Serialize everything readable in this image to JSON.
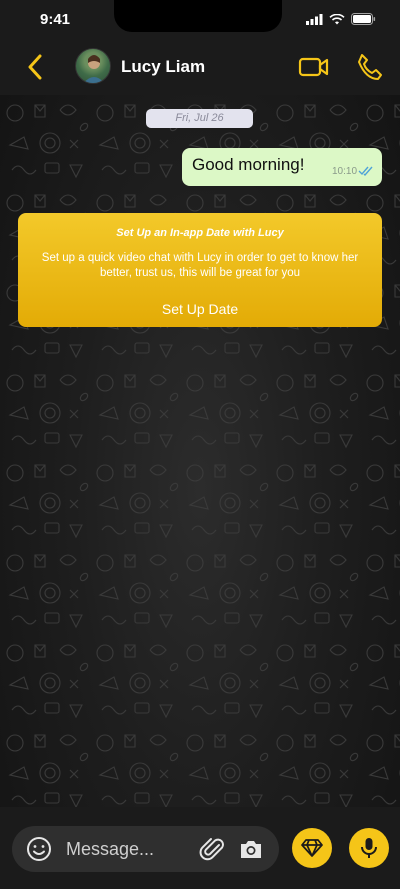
{
  "status_bar": {
    "time": "9:41"
  },
  "header": {
    "contact_name": "Lucy Liam",
    "back_icon": "chevron-left-icon",
    "video_icon": "video-camera-icon",
    "call_icon": "phone-icon"
  },
  "chat": {
    "date_label": "Fri, Jul 26",
    "messages": [
      {
        "text": "Good morning!",
        "time": "10:10",
        "status": "read"
      }
    ],
    "date_card": {
      "title": "Set Up an In-app Date with Lucy",
      "body": "Set up a quick video chat with Lucy in order to get to know her better, trust us, this will be great for you",
      "button_label": "Set Up Date"
    }
  },
  "composer": {
    "placeholder": "Message...",
    "value": ""
  },
  "colors": {
    "accent": "#f5c518",
    "outgoing_bubble": "#dcf8c6",
    "background": "#1b1b1b"
  }
}
